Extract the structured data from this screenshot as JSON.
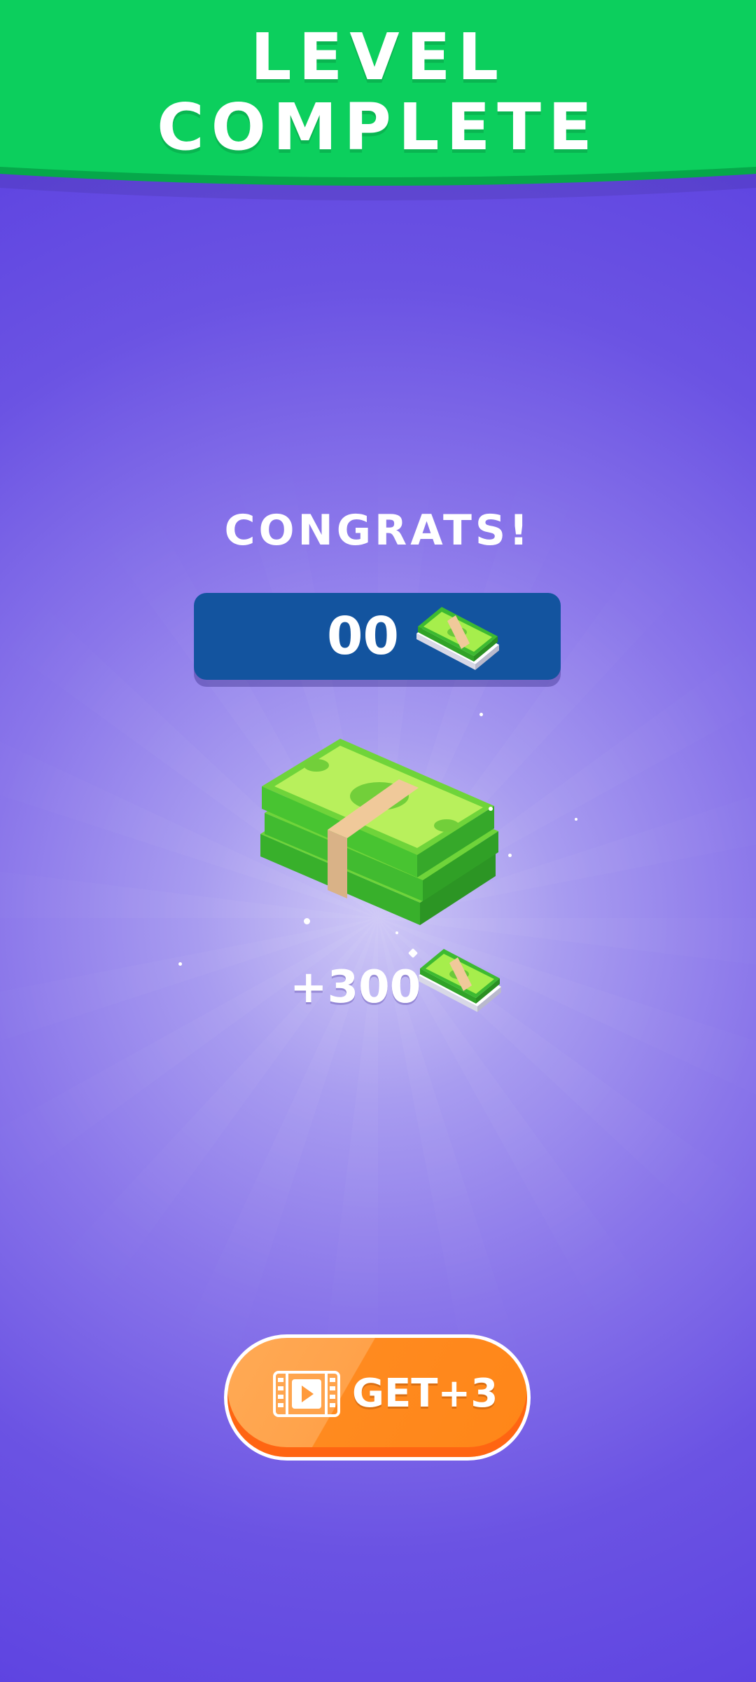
{
  "banner": {
    "title_line1": "LEVEL",
    "title_line2": "COMPLETE",
    "color": "#0ccf5d"
  },
  "congrats_text": "CONGRATS!",
  "balance": {
    "value": "00",
    "icon": "cash-stack-icon",
    "background": "#13549f"
  },
  "reward": {
    "amount": "+300",
    "icon": "cash-stack-icon"
  },
  "get_button": {
    "label": "GET+3",
    "icon": "video-ad-icon",
    "color": "#ff8a1f"
  },
  "colors": {
    "background": "#6b53e3",
    "cash_green": "#7edc3f",
    "band": "#f0c99a"
  }
}
